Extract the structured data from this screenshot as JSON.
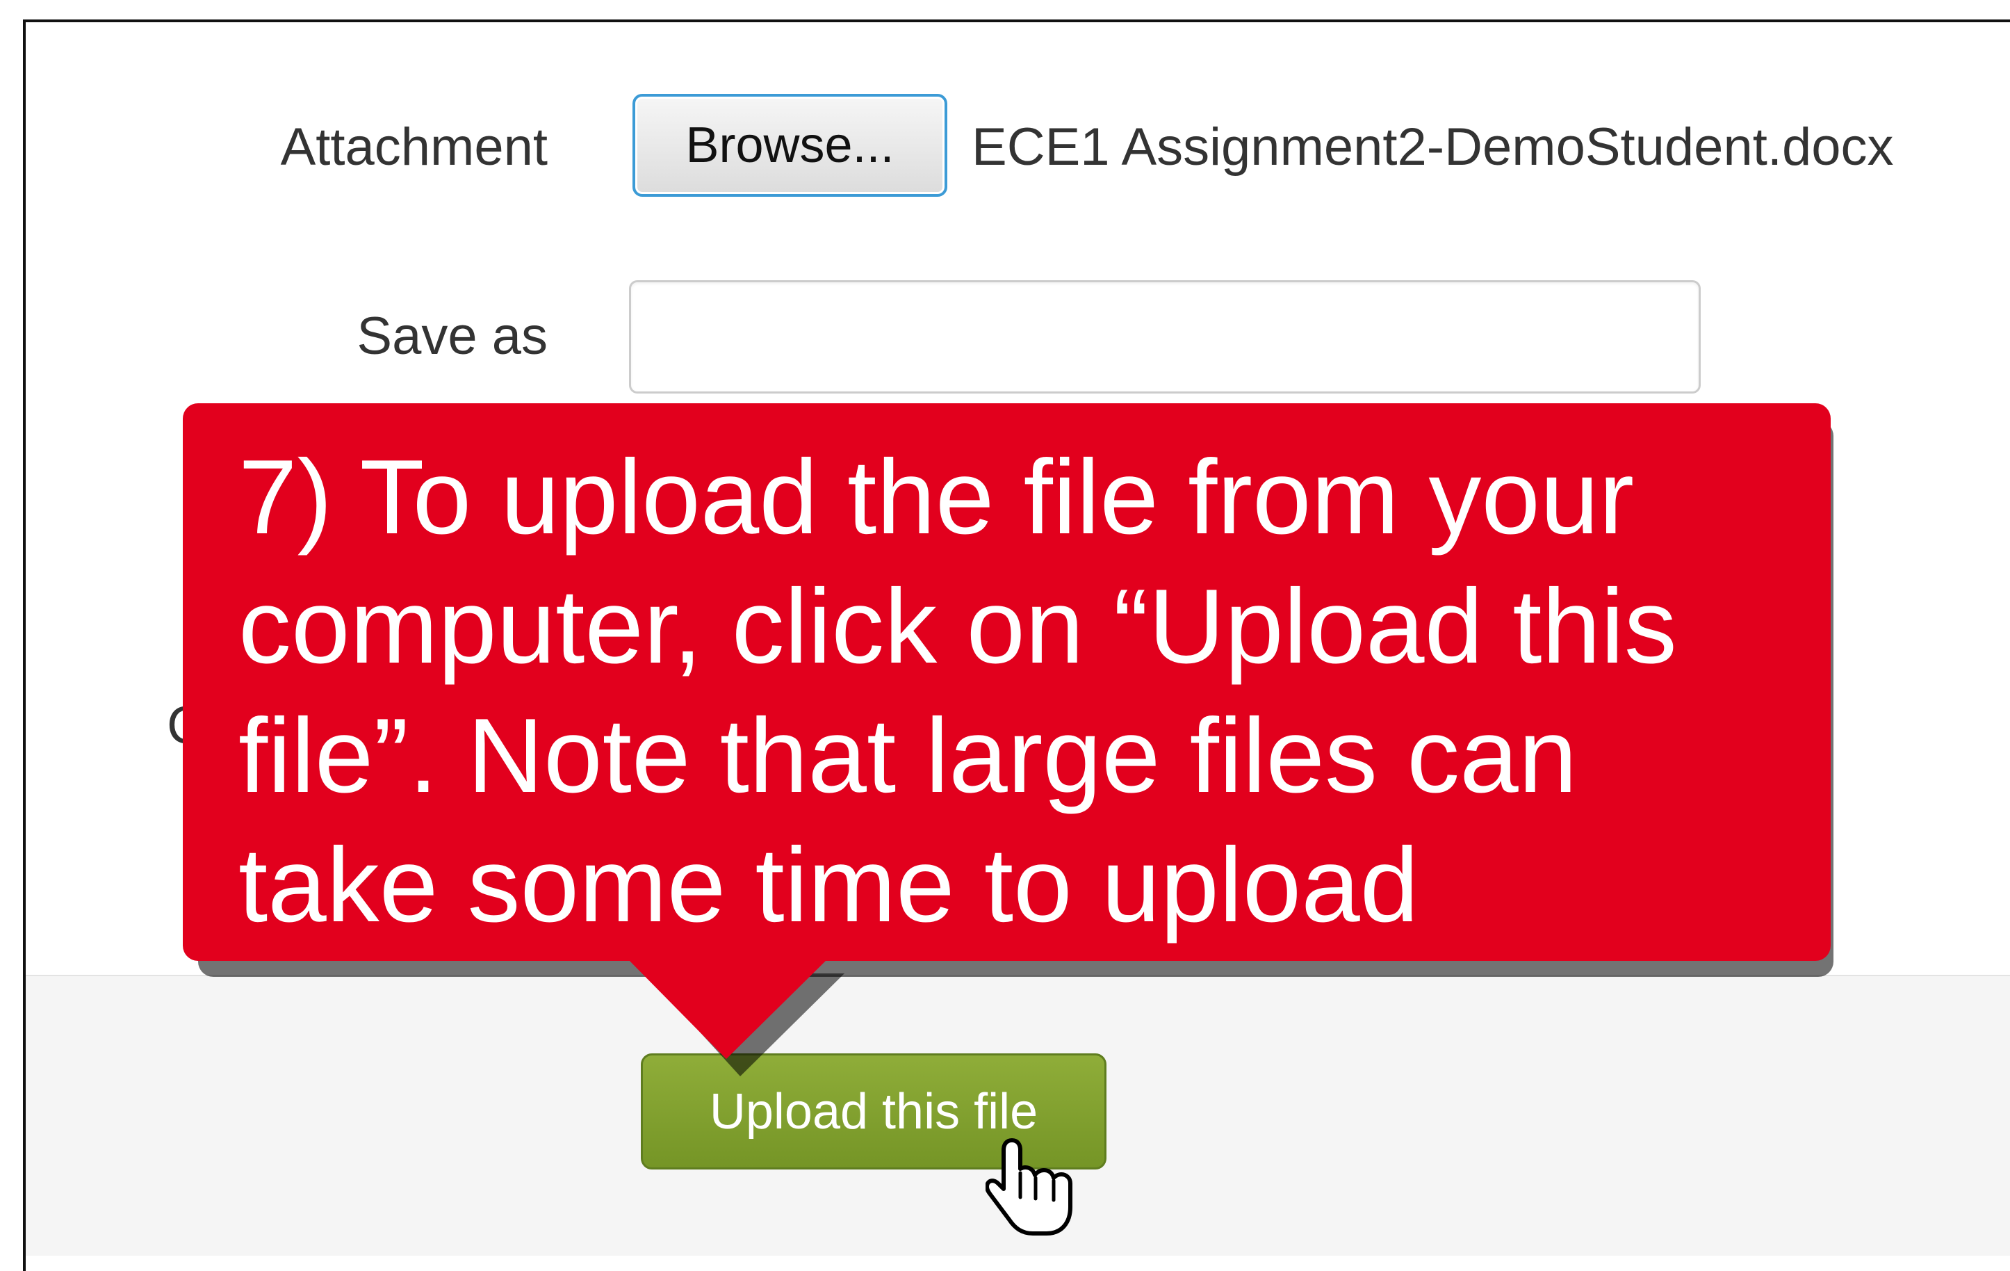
{
  "form": {
    "attachment_label": "Attachment",
    "browse_label": "Browse...",
    "file_name": "ECE1 Assignment2-DemoStudent.docx",
    "save_as_label": "Save as",
    "save_as_value": "",
    "upload_label": "Upload this file"
  },
  "callout": {
    "text": "7) To upload the file from your computer, click on “Upload this file”. Note that large files can take some time to upload",
    "color": "#e2001d"
  },
  "icons": {
    "cursor": "hand-pointer-icon"
  },
  "colors": {
    "upload_button": "#7f9e2d",
    "browse_border": "#3c9bd6"
  }
}
